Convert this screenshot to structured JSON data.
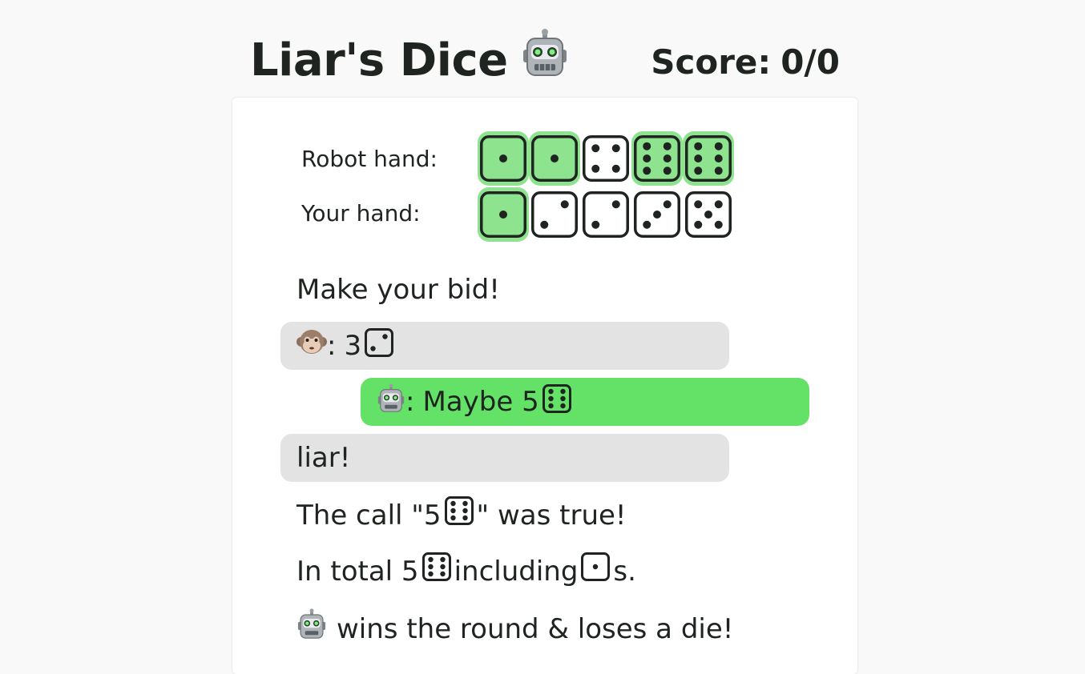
{
  "header": {
    "title": "Liar's Dice",
    "title_icon": "robot-icon",
    "score_label": "Score:",
    "score_value": "0/0"
  },
  "hands": {
    "robot_label": "Robot hand:",
    "your_label": "Your hand:",
    "robot_dice": [
      {
        "face": 1,
        "highlighted": true
      },
      {
        "face": 1,
        "highlighted": true
      },
      {
        "face": 4,
        "highlighted": false
      },
      {
        "face": 6,
        "highlighted": true
      },
      {
        "face": 6,
        "highlighted": true
      }
    ],
    "your_dice": [
      {
        "face": 1,
        "highlighted": true
      },
      {
        "face": 2,
        "highlighted": false
      },
      {
        "face": 2,
        "highlighted": false
      },
      {
        "face": 3,
        "highlighted": false
      },
      {
        "face": 5,
        "highlighted": false
      }
    ],
    "highlight_color": "#8ee38f"
  },
  "log": {
    "prompt": "Make your bid!",
    "player_bid": {
      "icon": "monkey-icon",
      "sep": ":",
      "text": "3"
    },
    "robot_bid": {
      "icon": "robot-icon",
      "sep": ":",
      "text": "Maybe 5"
    },
    "player_call": "liar!",
    "result_line1_pre": "The call \"5",
    "result_line1_post": "\" was true!",
    "result_line2_pre": "In total 5",
    "result_line2_mid": "including",
    "result_line2_post": "s.",
    "result_line3": "wins the round & loses a die!"
  },
  "colors": {
    "player_bubble": "#e3e3e3",
    "robot_bubble": "#64e267"
  }
}
